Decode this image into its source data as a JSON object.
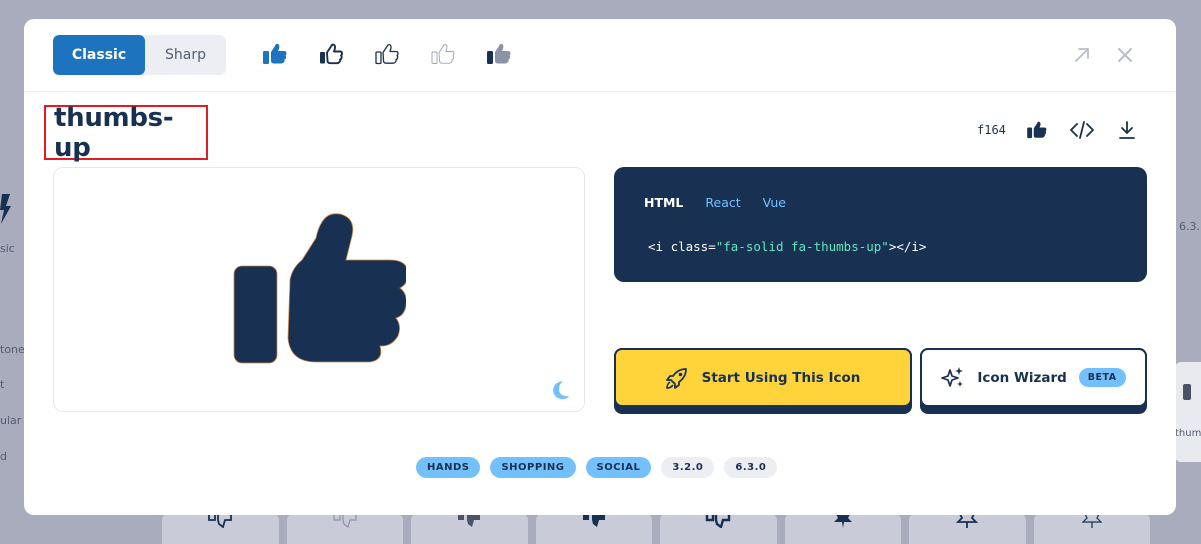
{
  "background": {
    "left_labels": [
      "sic",
      "tone",
      "t",
      "ular",
      "d"
    ],
    "right_version": "6.3.",
    "right_card_label": "thumb"
  },
  "modal": {
    "style_toggle": {
      "active": "Classic",
      "inactive": "Sharp"
    },
    "variant_icons": [
      "thumbs-up-solid",
      "thumbs-up-regular",
      "thumbs-up-light",
      "thumbs-up-thin",
      "thumbs-up-duotone"
    ],
    "icon_name": "thumbs-up",
    "unicode": "f164",
    "code_panel": {
      "tabs": [
        "HTML",
        "React",
        "Vue"
      ],
      "active_tab": "HTML",
      "code_prefix": "<i class=",
      "code_string": "\"fa-solid fa-thumbs-up\"",
      "code_suffix": "></i>"
    },
    "start_button": "Start Using This Icon",
    "wizard_button": "Icon Wizard",
    "beta_badge": "BETA",
    "category_tags": [
      "HANDS",
      "SHOPPING",
      "SOCIAL"
    ],
    "version_tags": [
      "3.2.0",
      "6.3.0"
    ]
  },
  "colors": {
    "brand_blue": "#1e73be",
    "navy": "#183153",
    "yellow": "#ffd43b",
    "light_blue": "#74c0fc",
    "code_string": "#63e6be",
    "highlight_red": "#e31b23"
  }
}
